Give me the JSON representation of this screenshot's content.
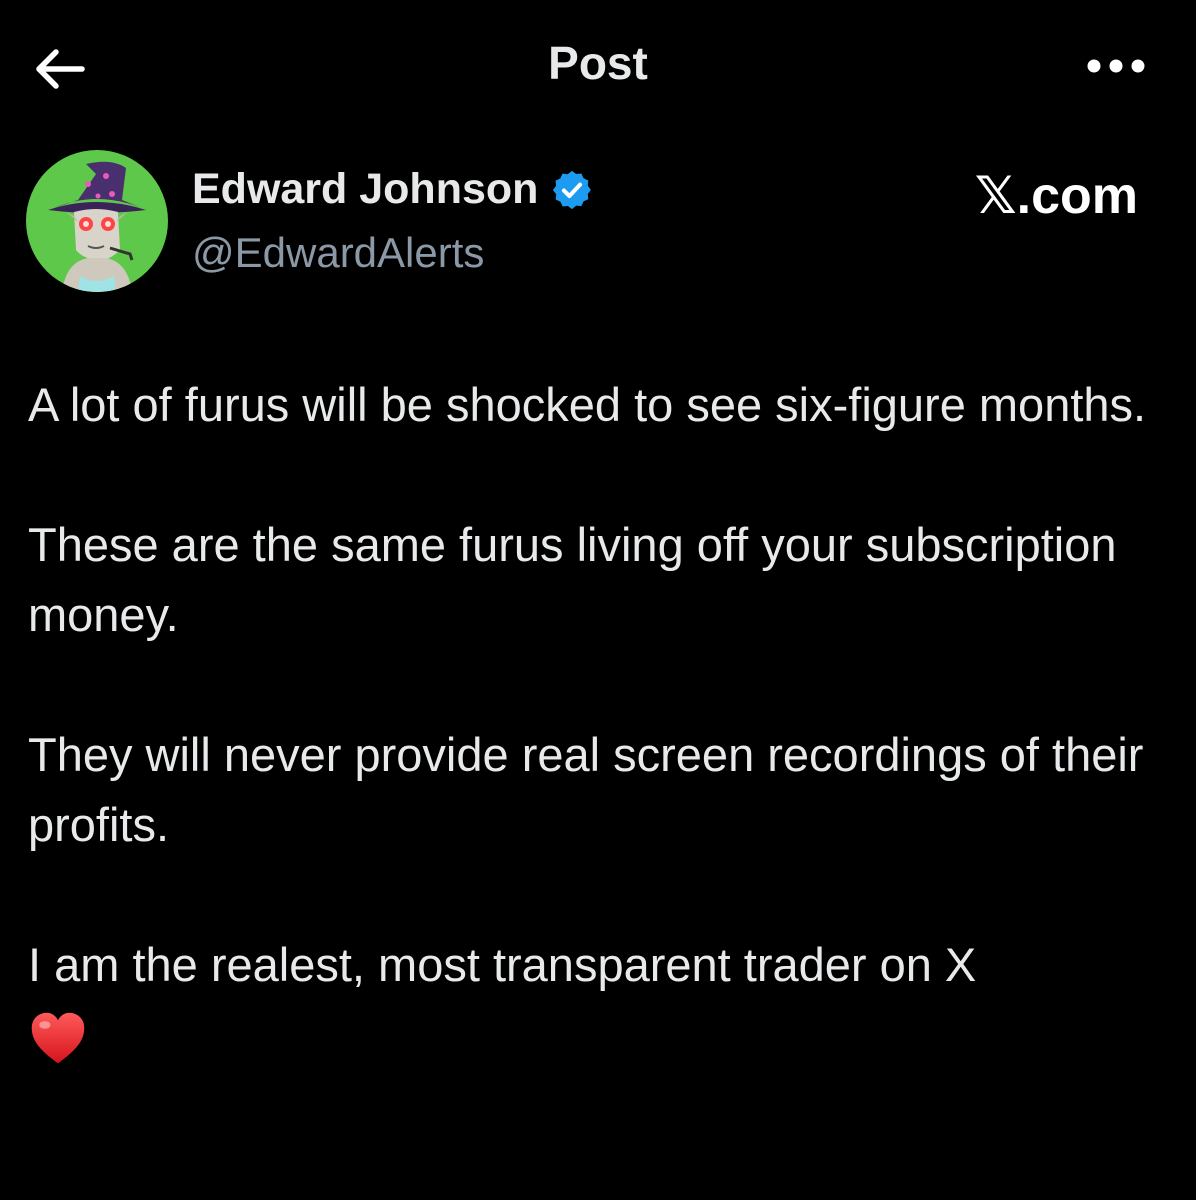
{
  "header": {
    "title": "Post",
    "back_icon": "arrow-left-icon",
    "more_icon": "more-horizontal-icon"
  },
  "author": {
    "display_name": "Edward Johnson",
    "handle": "@EdwardAlerts",
    "verified": true,
    "verified_color": "#1d9bf0",
    "avatar_bg": "#5ec84a"
  },
  "watermark": "𝕏.com",
  "post": {
    "paragraphs": [
      "A lot of furus will be shocked to see six-figure months.",
      "These are the same furus living off your subscription money.",
      "They will never provide real screen recordings of their profits.",
      "I am the realest, most transparent trader on X"
    ],
    "trailing_emoji": "heart-emoji"
  },
  "colors": {
    "background": "#000000",
    "text_primary": "#e7e9ea",
    "text_secondary": "#8b98a5"
  }
}
